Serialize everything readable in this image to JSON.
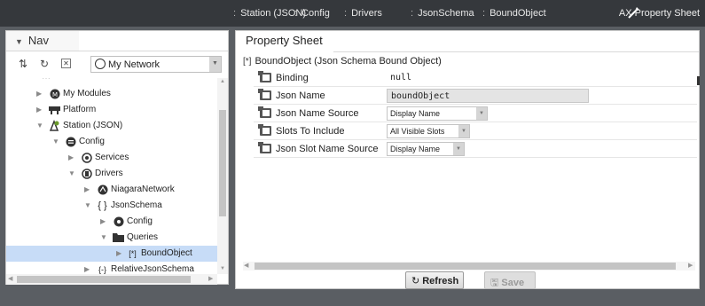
{
  "breadcrumbs": [
    {
      "label": "Station (JSON)"
    },
    {
      "label": "Config"
    },
    {
      "label": "Drivers"
    },
    {
      "label": "JsonSchema"
    },
    {
      "label": "BoundObject"
    }
  ],
  "view_name": "AX Property Sheet",
  "nav": {
    "tab_label": "Nav",
    "network_select": "My Network",
    "tree": [
      {
        "label": "My Modules",
        "icon": "modules-icon"
      },
      {
        "label": "Platform",
        "icon": "platform-icon"
      },
      {
        "label": "Station (JSON)",
        "icon": "station-icon"
      },
      {
        "label": "Config",
        "icon": "config-icon"
      },
      {
        "label": "Services",
        "icon": "services-icon"
      },
      {
        "label": "Drivers",
        "icon": "drivers-icon"
      },
      {
        "label": "NiagaraNetwork",
        "icon": "niagara-network-icon"
      },
      {
        "label": "JsonSchema",
        "icon": "json-schema-icon"
      },
      {
        "label": "Config",
        "icon": "gear-icon"
      },
      {
        "label": "Queries",
        "icon": "folder-icon"
      },
      {
        "label": "BoundObject",
        "icon": "bound-object-icon"
      },
      {
        "label": "RelativeJsonSchema",
        "icon": "relative-schema-icon"
      }
    ]
  },
  "property_sheet": {
    "tab_label": "Property Sheet",
    "object_title": "BoundObject  (Json Schema Bound Object)",
    "properties": [
      {
        "name": "Binding",
        "value": "null"
      },
      {
        "name": "Json Name",
        "value": "boundObject"
      },
      {
        "name": "Json Name Source",
        "value": "Display Name"
      },
      {
        "name": "Slots To Include",
        "value": "All Visible Slots"
      },
      {
        "name": "Json Slot Name Source",
        "value": "Display Name"
      }
    ],
    "refresh_label": "Refresh",
    "save_label": "Save"
  }
}
